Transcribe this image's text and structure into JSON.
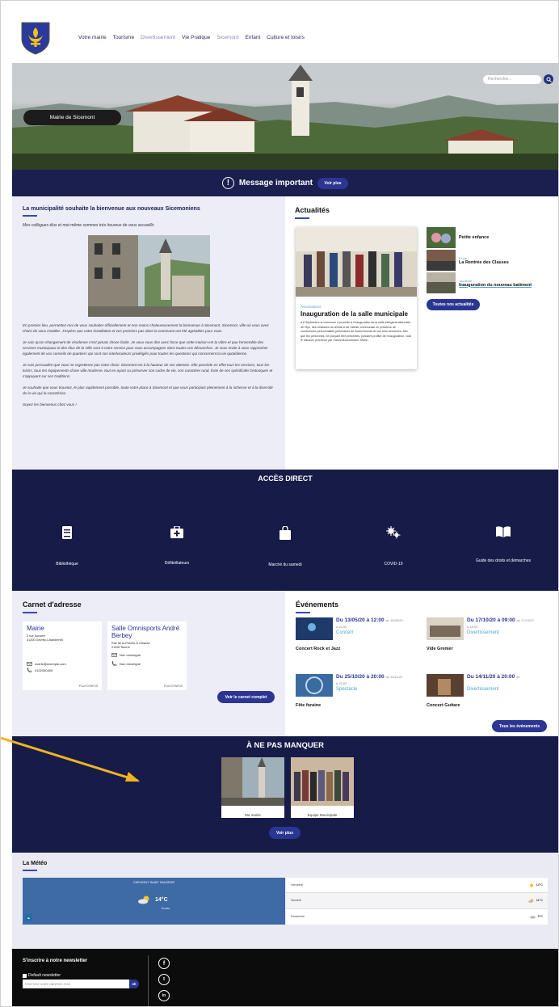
{
  "nav": {
    "items": [
      "Votre mairie",
      "Tourisme",
      "Divertissement",
      "Vie Pratique",
      "Sicemont",
      "Enfant",
      "Culture et loisirs"
    ],
    "muted": [
      2,
      4
    ]
  },
  "hero": {
    "search_placeholder": "Rechercher...",
    "mairie_label": "Mairie de Sicemont"
  },
  "message": {
    "title": "Message important",
    "button": "Voir plus"
  },
  "welcome": {
    "title": "La municipalité souhaite la bienvenue aux nouveaux Sicemoniens",
    "intro": "Mes collègues élus et moi-même sommes très heureux de vous accueillir.",
    "paragraphs": [
      "En premier lieu, permettez-moi de vous souhaiter officiellement et non moins chaleureusement la bienvenue à Sicemont. Sicemont, ville où vous avez choisi de vous installer. J'espère que votre installation et vos premiers pas dans la commune ont été agréables pour vous.",
      "Je sais qu'un changement de résidence n'est jamais chose facile. Je veux vous dire avec force que cette maison est la vôtre et que l'ensemble des services municipaux et des élus de la Ville sont à votre service pour vous accompagner dans toutes vos démarches. Je vous invite à vous rapprocher également de vos conseils de quartiers qui sont nos interlocuteurs privilégiés pour toutes les questions qui concernent la vie quotidienne.",
      "Je suis persuadée que vous ne regretterez pas votre choix: Sicemont est à la hauteur de vos attentes. Elle possède en effet tous les services, tous les loisirs, tous les équipements d'une ville moderne, tout en ayant su préserver son cadre de vie, son caractère rural, forte de ses spécificités historiques et s'appuyant sur ses traditions.",
      "Je souhaite que vous trouviez, le plus rapidement possible, toute votre place à Sicemont et que vous participiez pleinement à la richesse et à la diversité de la vie qui la caractérise.",
      "Soyez les bienvenus chez vous !"
    ]
  },
  "news": {
    "title": "Actualités",
    "featured": {
      "category": "Associations",
      "title": "Inauguration de la salle municipale",
      "text": "a 8 Septembre la commune à procédé à l'inauguration de la salle intergénérationnelle de l'Ilys, des vestiaires du tennis et de l'atelier communale en présence de nombreuses personnalités partenaires de financements de ces trois structures. Afin que les personnes, ne pouvant être présentes, puissent profiter de l'inauguration, voici le discours prononcé par Carole Bouncheaux, Maire."
    },
    "items": [
      {
        "category": "",
        "label": "Petite enfance"
      },
      {
        "category": "Ecole",
        "label": "La Rentrée des Classes"
      },
      {
        "category": "Tourisme",
        "label": "Inauguration du nouveau batiment"
      }
    ],
    "button": "Toutes nos actualités"
  },
  "acces": {
    "title": "ACCÈS DIRECT",
    "items": [
      "Bibliothèque",
      "Défibrillateurs",
      "Marché du samedi",
      "COVID-19",
      "Guide des droits et démarches"
    ],
    "icons": [
      "book-icon",
      "medkit-icon",
      "shopping-bag-icon",
      "virus-icon",
      "open-book-icon"
    ]
  },
  "carnet": {
    "title": "Carnet d'adresse",
    "cards": [
      {
        "name": "Mairie",
        "street": "2 rue Souvert",
        "city": "21200 Gevrey-Chambertin",
        "email": "mairie@exemple.com",
        "phone": "0102030405",
        "more": "PLUS D'INFOS"
      },
      {
        "name": "Salle Omnisports André Berbey",
        "street": "Rue de la Porche À l'Oiseau",
        "city": "21250 Seurre",
        "email": "Non renseigné",
        "phone": "Non renseigné",
        "more": "PLUS D'INFOS"
      }
    ],
    "button": "Voir le carnet complet"
  },
  "events": {
    "title": "Événements",
    "items": [
      {
        "date": "Du 13/05/20 à 12:00",
        "until": "au 15/06/20",
        "hour": "à 23:00",
        "category": "Concert",
        "title": "Concert Rock et Jazz"
      },
      {
        "date": "Du 17/10/20 à 09:00",
        "until": "au 17/10/20",
        "hour": "à 18:00",
        "category": "Divertissement",
        "title": "Vide Grenier"
      },
      {
        "date": "Du 25/10/20 à 20:00",
        "until": "au 15/11/20",
        "hour": "à 23:00",
        "category": "Spectacle",
        "title": "Fête foraine"
      },
      {
        "date": "Du 14/11/20 à 20:00",
        "until": "au",
        "hour": "",
        "category": "Divertissement",
        "title": "Concert Guitare"
      }
    ],
    "button": "Tous les événements"
  },
  "manquer": {
    "title": "À NE PAS MANQUER",
    "items": [
      "Ma mairie",
      "Equipe Municipale"
    ],
    "button": "Voir plus"
  },
  "meteo": {
    "title": "La Météo",
    "city": "CHEVIGNY SAINT SAUVEUR",
    "temp": "14°C",
    "sub": "Brouillé",
    "rows": [
      {
        "day": "Vendredi",
        "temp": "14°C"
      },
      {
        "day": "Samedi",
        "temp": "11°C"
      },
      {
        "day": "Dimanche",
        "temp": "9°C"
      }
    ]
  },
  "newsletter": {
    "title": "S'inscrire à notre newsletter",
    "checkbox": "Default newsletter",
    "placeholder": "Inscrivez votre adresse mail",
    "button": "ok",
    "social": [
      "f",
      "t",
      "in"
    ]
  },
  "colors": {
    "navy": "#171b48",
    "accent": "#2b3592",
    "light": "#ecedf7",
    "cyan": "#4aa6d8",
    "arrow": "#f0b323"
  }
}
